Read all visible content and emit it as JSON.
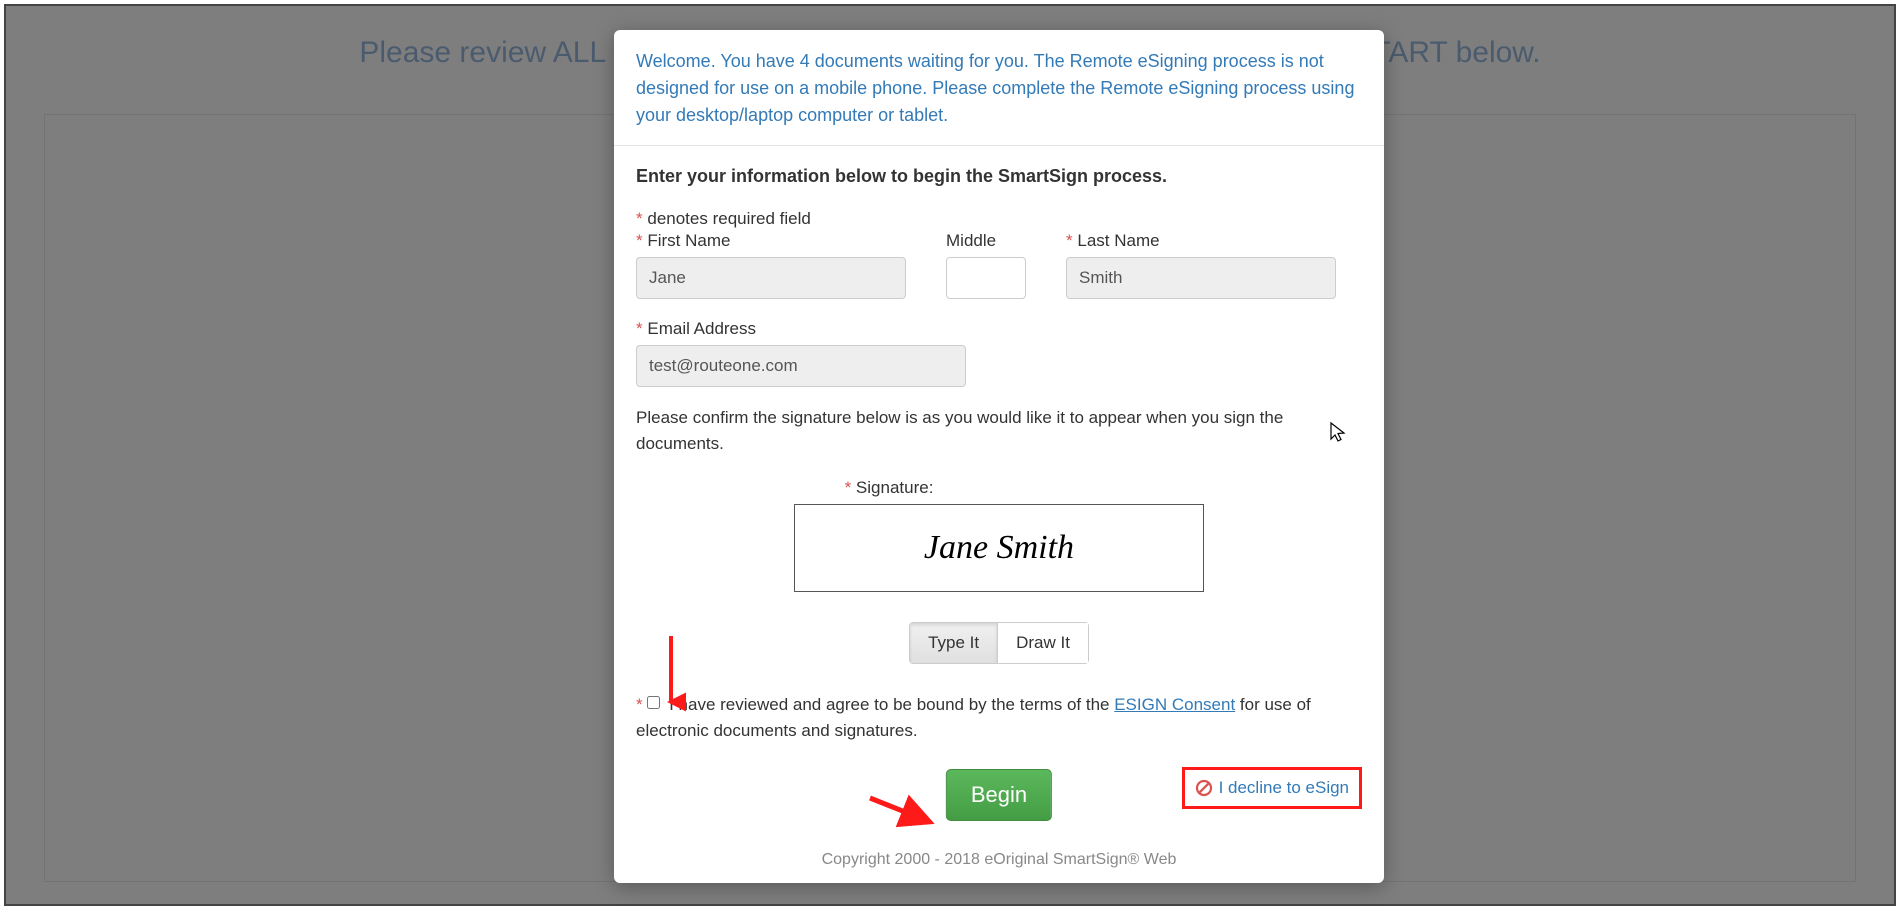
{
  "background": {
    "header_text": "Please review ALL documents and then acknowledge reading by selecting START below."
  },
  "modal": {
    "welcome_text": "Welcome. You have 4 documents waiting for you. The Remote eSigning process is not designed for use on a mobile phone. Please complete the Remote eSigning process using your desktop/laptop computer or tablet.",
    "instruction": "Enter your information below to begin the SmartSign process.",
    "required_note": "denotes required field",
    "fields": {
      "first_name": {
        "label": "First Name",
        "value": "Jane"
      },
      "middle": {
        "label": "Middle",
        "value": ""
      },
      "last_name": {
        "label": "Last Name",
        "value": "Smith"
      },
      "email": {
        "label": "Email Address",
        "value": "test@routeone.com"
      }
    },
    "signature_confirm": "Please confirm the signature below is as you would like it to appear when you sign the documents.",
    "signature_label": "Signature:",
    "signature_value": "Jane Smith",
    "toggle": {
      "type_it": "Type It",
      "draw_it": "Draw It"
    },
    "consent": {
      "prefix": "I have reviewed and agree to be bound by the terms of the ",
      "link": "ESIGN Consent",
      "suffix": " for use of electronic documents and signatures."
    },
    "begin_label": "Begin",
    "decline_label": "I decline to eSign",
    "copyright": "Copyright 2000 - 2018 eOriginal SmartSign® Web"
  }
}
